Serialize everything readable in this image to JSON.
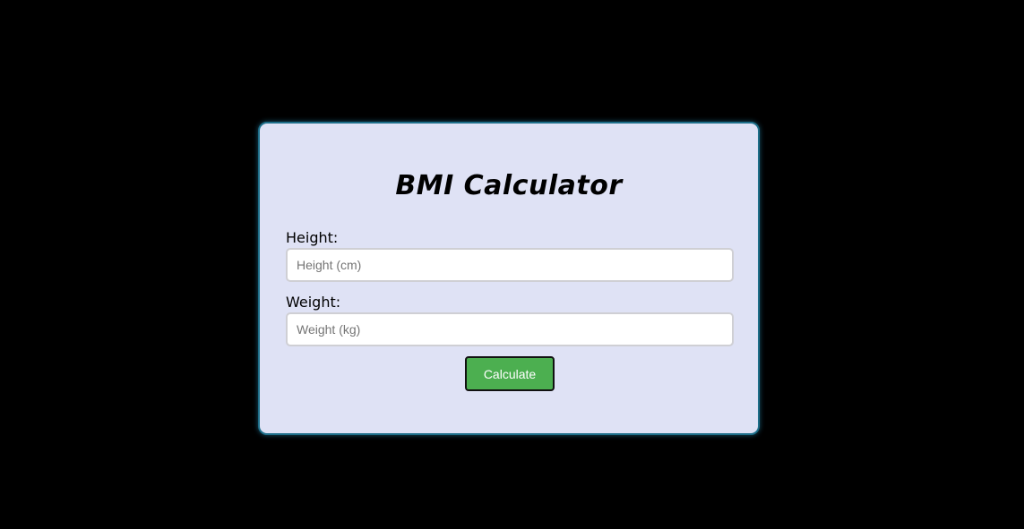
{
  "app": {
    "title": "BMI Calculator"
  },
  "form": {
    "height_label": "Height:",
    "height_placeholder": "Height (cm)",
    "height_value": "",
    "weight_label": "Weight:",
    "weight_placeholder": "Weight (kg)",
    "weight_value": "",
    "submit_label": "Calculate"
  },
  "colors": {
    "page_background": "#000000",
    "card_background": "#dfe2f5",
    "card_border": "#1e6f8a",
    "button_background": "#4caf50",
    "button_text": "#ffffff"
  }
}
